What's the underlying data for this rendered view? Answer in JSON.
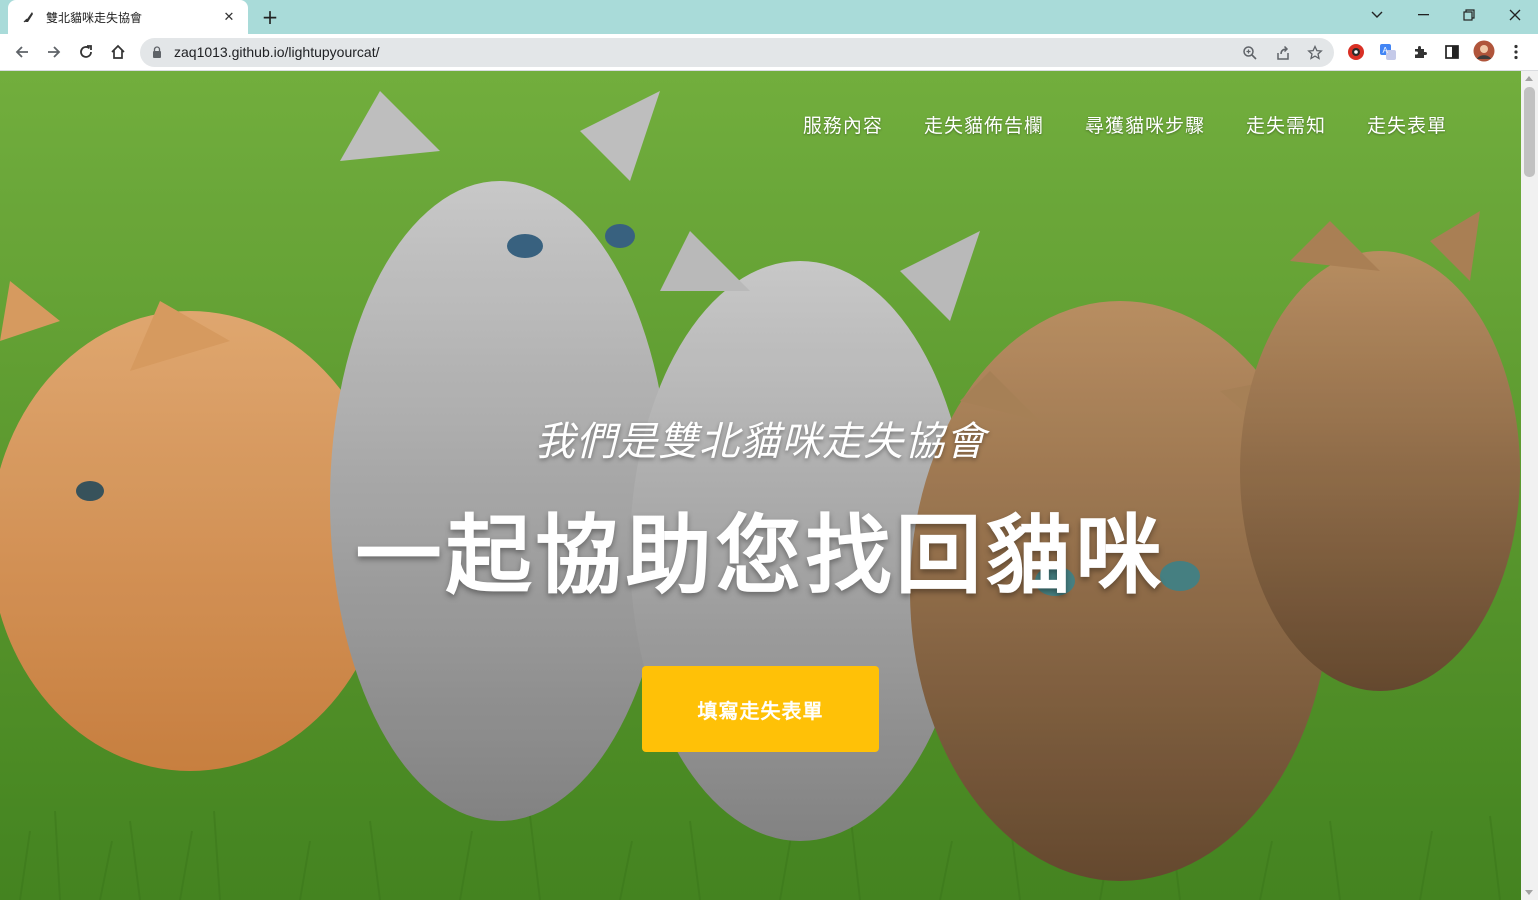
{
  "browser": {
    "tab_title": "雙北貓咪走失協會",
    "tab_close_glyph": "✕",
    "new_tab_glyph": "+",
    "url": "zaq1013.github.io/lightupyourcat/",
    "window_controls": {
      "dropdown": "⌄",
      "minimize": "—",
      "restore": "❐",
      "close": "✕"
    }
  },
  "site": {
    "nav": [
      "服務內容",
      "走失貓佈告欄",
      "尋獲貓咪步驟",
      "走失需知",
      "走失表單"
    ],
    "subtitle": "我們是雙北貓咪走失協會",
    "headline": "一起協助您找回貓咪",
    "cta_label": "填寫走失表單"
  },
  "colors": {
    "tabbar": "#a9dbd9",
    "cta": "#ffc107",
    "grass": "#5ea32f"
  },
  "icons": [
    "favicon-icon",
    "back-icon",
    "forward-icon",
    "reload-icon",
    "home-icon",
    "lock-icon",
    "zoom-icon",
    "share-icon",
    "bookmark-star-icon",
    "extension-red-icon",
    "translate-icon",
    "puzzle-icon",
    "sidepanel-icon",
    "profile-avatar",
    "menu-icon"
  ]
}
